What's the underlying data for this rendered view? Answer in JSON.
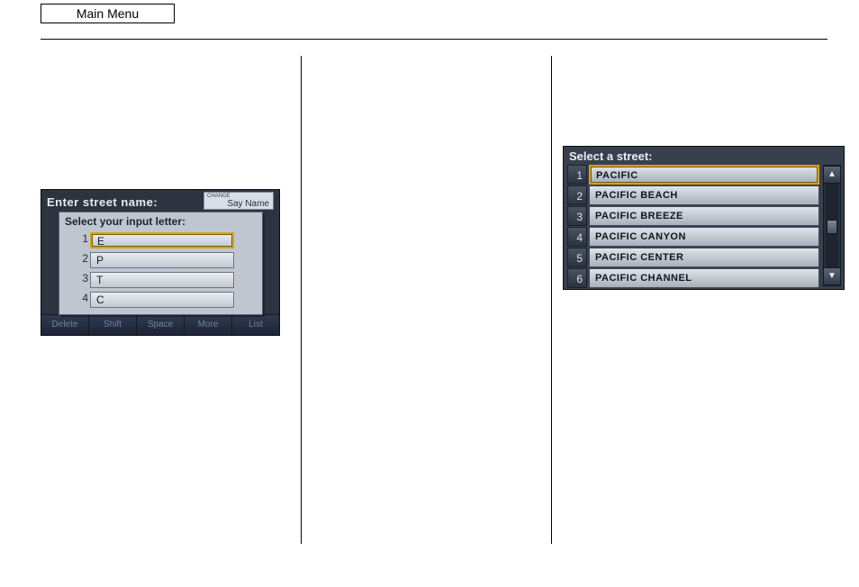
{
  "header": {
    "main_menu": "Main Menu"
  },
  "screen1": {
    "title": "Enter street name:",
    "say_name_small": "CHANGE",
    "say_name": "Say Name",
    "popup_title": "Select your input letter:",
    "rows": [
      {
        "idx": "1",
        "value": "E",
        "selected": true
      },
      {
        "idx": "2",
        "value": "P",
        "selected": false
      },
      {
        "idx": "3",
        "value": "T",
        "selected": false
      },
      {
        "idx": "4",
        "value": "C",
        "selected": false
      }
    ],
    "bottom": [
      "Delete",
      "Shift",
      "Space",
      "More",
      "List"
    ]
  },
  "screen2": {
    "title": "Select a street:",
    "rows": [
      {
        "idx": "1",
        "value": "PACIFIC",
        "selected": true
      },
      {
        "idx": "2",
        "value": "PACIFIC BEACH",
        "selected": false
      },
      {
        "idx": "3",
        "value": "PACIFIC BREEZE",
        "selected": false
      },
      {
        "idx": "4",
        "value": "PACIFIC CANYON",
        "selected": false
      },
      {
        "idx": "5",
        "value": "PACIFIC CENTER",
        "selected": false
      },
      {
        "idx": "6",
        "value": "PACIFIC CHANNEL",
        "selected": false
      }
    ],
    "scroll": {
      "up": "▲",
      "down": "▼"
    }
  }
}
